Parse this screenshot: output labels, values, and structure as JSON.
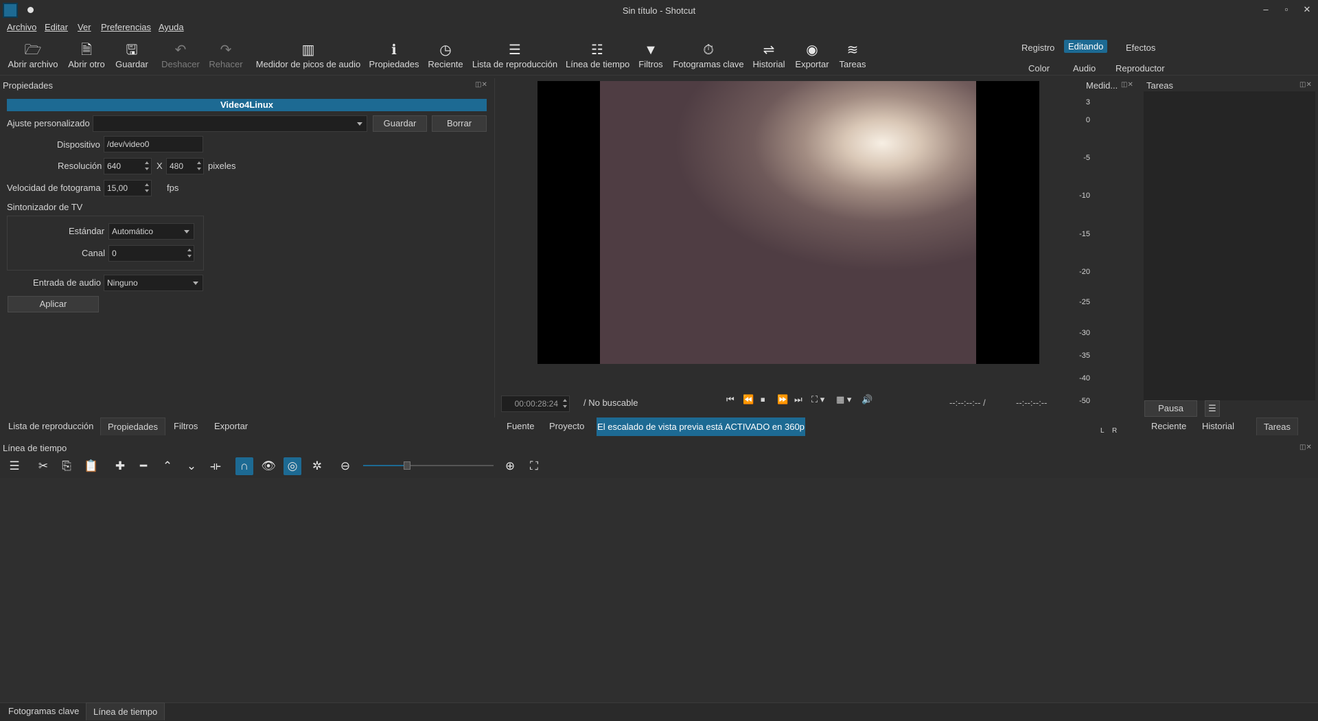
{
  "window": {
    "title": "Sin título - Shotcut",
    "minimize": "–",
    "maximize": "▫",
    "close": "✕"
  },
  "menu": {
    "items": [
      "Archivo",
      "Editar",
      "Ver",
      "Preferencias",
      "Ayuda"
    ]
  },
  "toolbar": {
    "buttons": [
      {
        "label": "Abrir archivo",
        "icon": "folder-open-icon",
        "glyph": "🗁"
      },
      {
        "label": "Abrir otro",
        "icon": "open-other-icon",
        "glyph": "🗎"
      },
      {
        "label": "Guardar",
        "icon": "save-icon",
        "glyph": "🖫"
      },
      {
        "label": "Deshacer",
        "icon": "undo-icon",
        "glyph": "↶"
      },
      {
        "label": "Rehacer",
        "icon": "redo-icon",
        "glyph": "↷"
      },
      {
        "label": "Medidor de picos de audio",
        "icon": "audio-meter-icon",
        "glyph": "▥"
      },
      {
        "label": "Propiedades",
        "icon": "info-icon",
        "glyph": "ℹ"
      },
      {
        "label": "Reciente",
        "icon": "clock-icon",
        "glyph": "◷"
      },
      {
        "label": "Lista de reproducción",
        "icon": "list-icon",
        "glyph": "☰"
      },
      {
        "label": "Línea de tiempo",
        "icon": "timeline-icon",
        "glyph": "☷"
      },
      {
        "label": "Filtros",
        "icon": "filter-icon",
        "glyph": "▼"
      },
      {
        "label": "Fotogramas clave",
        "icon": "stopwatch-icon",
        "glyph": "⏱"
      },
      {
        "label": "Historial",
        "icon": "history-icon",
        "glyph": "⇌"
      },
      {
        "label": "Exportar",
        "icon": "export-icon",
        "glyph": "◉"
      },
      {
        "label": "Tareas",
        "icon": "jobs-icon",
        "glyph": "≋"
      }
    ],
    "layouts": {
      "registro": "Registro",
      "editando": "Editando",
      "efectos": "Efectos",
      "color": "Color",
      "audio": "Audio",
      "reproductor": "Reproductor"
    }
  },
  "properties": {
    "panel_title": "Propiedades",
    "header": "Video4Linux",
    "preset_label": "Ajuste personalizado",
    "preset_value": "",
    "save_button": "Guardar",
    "delete_button": "Borrar",
    "device_label": "Dispositivo",
    "device_value": "/dev/video0",
    "resolution_label": "Resolución",
    "width": "640",
    "x_sep": "X",
    "height": "480",
    "pixels_unit": "pixeles",
    "framerate_label": "Velocidad de fotograma",
    "framerate_value": "15,00",
    "fps_unit": "fps",
    "tv_tuner_label": "Sintonizador de TV",
    "standard_label": "Estándar",
    "standard_value": "Automático",
    "channel_label": "Canal",
    "channel_value": "0",
    "audio_input_label": "Entrada de audio",
    "audio_input_value": "Ninguno",
    "apply_button": "Aplicar"
  },
  "left_tabs": [
    "Lista de reproducción",
    "Propiedades",
    "Filtros",
    "Exportar"
  ],
  "player": {
    "timecode": "00:00:28:24",
    "duration": "/ No buscable",
    "in_point": "--:--:--:-- /",
    "out_point": "--:--:--:--",
    "tabs": [
      "Fuente",
      "Proyecto"
    ],
    "notice": "El escalado de vista previa está ACTIVADO en 360p"
  },
  "meter": {
    "title": "Medid...",
    "scale": [
      "3",
      "0",
      "-5",
      "-10",
      "-15",
      "-20",
      "-25",
      "-30",
      "-35",
      "-40",
      "-50"
    ],
    "channels": [
      "L",
      "R"
    ]
  },
  "jobs": {
    "title": "Tareas",
    "pause_button": "Pausa",
    "menu_glyph": "☰",
    "tabs": [
      "Reciente",
      "Historial",
      "Tareas"
    ]
  },
  "timeline": {
    "title": "Línea de tiempo"
  },
  "bottom_tabs": [
    "Fotogramas clave",
    "Línea de tiempo"
  ],
  "colors": {
    "accent": "#1d6a93",
    "background": "#2d2d2d"
  }
}
